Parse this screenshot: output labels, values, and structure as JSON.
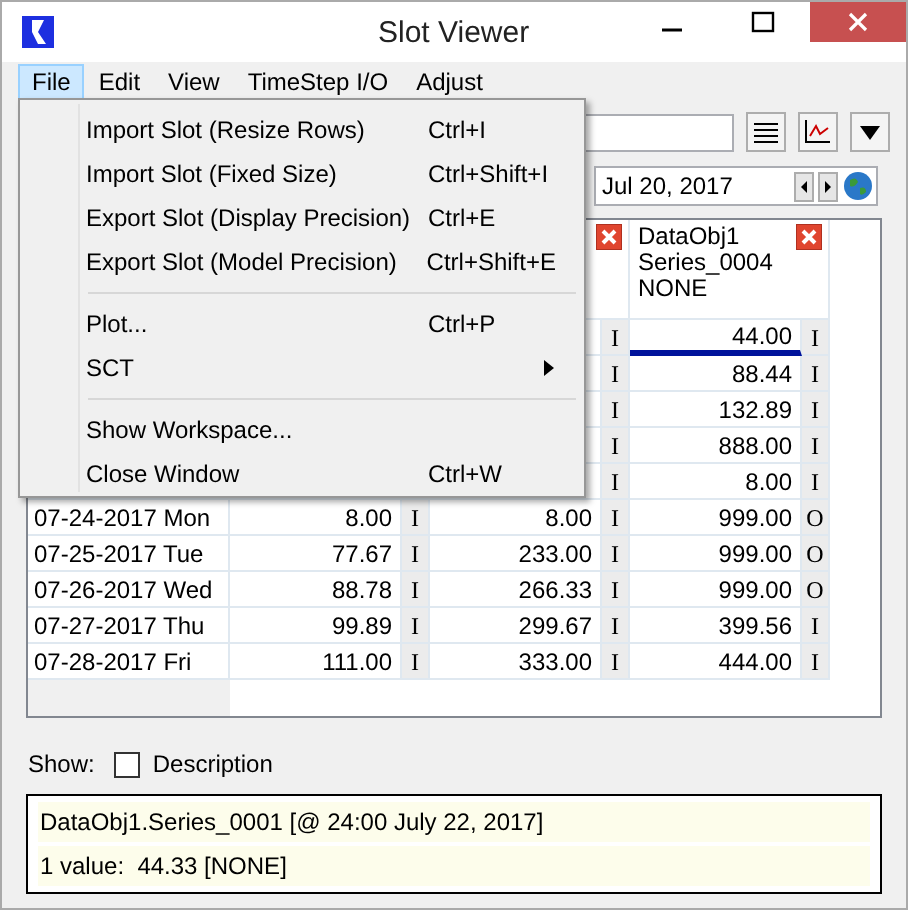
{
  "window": {
    "title": "Slot Viewer"
  },
  "menubar": [
    {
      "label": "File",
      "selected": true
    },
    {
      "label": "Edit",
      "selected": false
    },
    {
      "label": "View",
      "selected": false
    },
    {
      "label": "TimeStep I/O",
      "selected": false
    },
    {
      "label": "Adjust",
      "selected": false
    }
  ],
  "file_menu": [
    {
      "kind": "item",
      "label": "Import Slot (Resize Rows)",
      "shortcut": "Ctrl+I"
    },
    {
      "kind": "item",
      "label": "Import Slot (Fixed Size)",
      "shortcut": "Ctrl+Shift+I"
    },
    {
      "kind": "item",
      "label": "Export Slot (Display Precision)",
      "shortcut": "Ctrl+E"
    },
    {
      "kind": "item",
      "label": "Export Slot (Model Precision)",
      "shortcut": "Ctrl+Shift+E"
    },
    {
      "kind": "separator"
    },
    {
      "kind": "item",
      "label": "Plot...",
      "shortcut": "Ctrl+P"
    },
    {
      "kind": "submenu",
      "label": "SCT"
    },
    {
      "kind": "separator"
    },
    {
      "kind": "item",
      "label": "Show Workspace..."
    },
    {
      "kind": "item",
      "label": "Close Window",
      "shortcut": "Ctrl+W"
    }
  ],
  "date_field": {
    "value": "Jul 20, 2017"
  },
  "table": {
    "columns": [
      null,
      {
        "close": true
      },
      {
        "close": true,
        "name": "DataObj1",
        "series": "Series_0004",
        "units": "NONE"
      }
    ],
    "rows": [
      {
        "current": true,
        "cells": [
          null,
          {
            "flag": "I"
          },
          {
            "value": "44.00",
            "flag": "I"
          }
        ]
      },
      {
        "current": false,
        "cells": [
          null,
          {
            "flag": "I"
          },
          {
            "value": "88.44",
            "flag": "I"
          }
        ]
      },
      {
        "current": false,
        "cells": [
          null,
          {
            "flag": "I"
          },
          {
            "value": "132.89",
            "flag": "I"
          }
        ]
      },
      {
        "current": false,
        "cells": [
          null,
          {
            "flag": "I"
          },
          {
            "value": "888.00",
            "flag": "I"
          }
        ]
      },
      {
        "current": false,
        "cells": [
          null,
          {
            "flag": "I"
          },
          {
            "value": "8.00",
            "flag": "I"
          }
        ]
      },
      {
        "current": false,
        "date": "07-24-2017 Mon",
        "cells": [
          {
            "value": "8.00",
            "flag": "I"
          },
          {
            "value": "8.00",
            "flag": "I"
          },
          {
            "value": "999.00",
            "flag": "O"
          }
        ]
      },
      {
        "current": false,
        "date": "07-25-2017 Tue",
        "cells": [
          {
            "value": "77.67",
            "flag": "I"
          },
          {
            "value": "233.00",
            "flag": "I"
          },
          {
            "value": "999.00",
            "flag": "O"
          }
        ]
      },
      {
        "current": false,
        "date": "07-26-2017 Wed",
        "cells": [
          {
            "value": "88.78",
            "flag": "I"
          },
          {
            "value": "266.33",
            "flag": "I"
          },
          {
            "value": "999.00",
            "flag": "O"
          }
        ]
      },
      {
        "current": false,
        "date": "07-27-2017 Thu",
        "cells": [
          {
            "value": "99.89",
            "flag": "I"
          },
          {
            "value": "299.67",
            "flag": "I"
          },
          {
            "value": "399.56",
            "flag": "I"
          }
        ]
      },
      {
        "current": false,
        "date": "07-28-2017 Fri",
        "cells": [
          {
            "value": "111.00",
            "flag": "I"
          },
          {
            "value": "333.00",
            "flag": "I"
          },
          {
            "value": "444.00",
            "flag": "I"
          }
        ]
      }
    ]
  },
  "show": {
    "label": "Show:",
    "description": {
      "label": "Description",
      "checked": false
    }
  },
  "info": [
    "DataObj1.Series_0001 [@ 24:00 July 22, 2017]",
    "1 value:  44.33 [NONE]"
  ]
}
